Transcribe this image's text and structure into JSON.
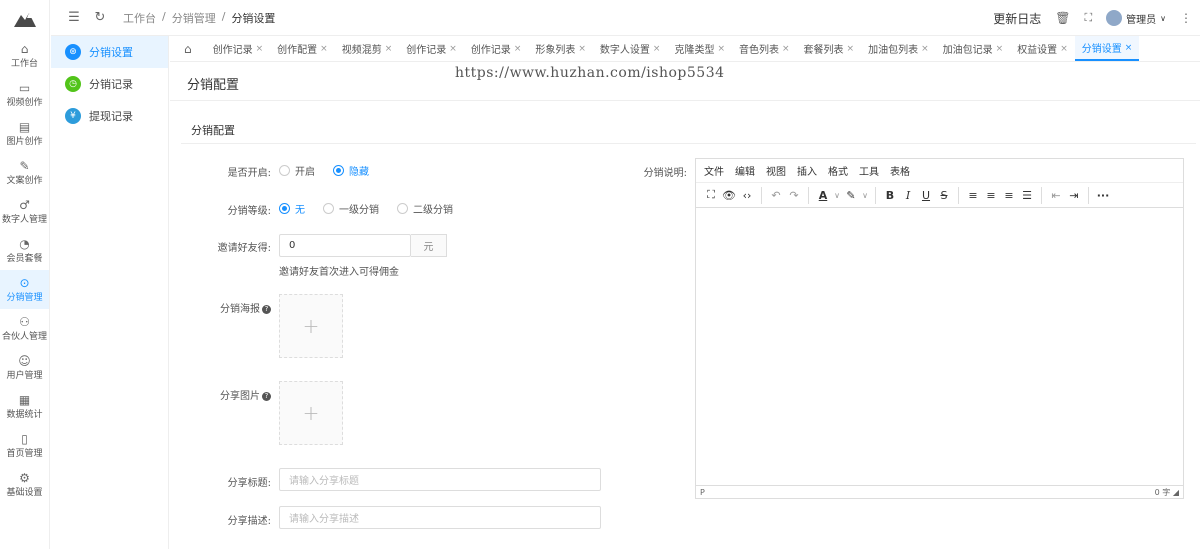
{
  "topbar": {
    "breadcrumb": [
      "工作台",
      "分销管理",
      "分销设置"
    ],
    "update_log": "更新日志",
    "user": "管理员"
  },
  "leftnav": [
    {
      "label": "工作台",
      "icon": "home-icon",
      "glyph": "⌂"
    },
    {
      "label": "视频创作",
      "icon": "video-icon",
      "glyph": "▭"
    },
    {
      "label": "图片创作",
      "icon": "image-icon",
      "glyph": "▤"
    },
    {
      "label": "文案创作",
      "icon": "document-icon",
      "glyph": "✎"
    },
    {
      "label": "数字人管理",
      "icon": "digital-human-icon",
      "glyph": "♂"
    },
    {
      "label": "会员套餐",
      "icon": "membership-icon",
      "glyph": "◔"
    },
    {
      "label": "分销管理",
      "icon": "distribution-icon",
      "glyph": "⊙"
    },
    {
      "label": "合伙人管理",
      "icon": "partner-icon",
      "glyph": "⚇"
    },
    {
      "label": "用户管理",
      "icon": "user-icon",
      "glyph": "☺"
    },
    {
      "label": "数据统计",
      "icon": "statistics-icon",
      "glyph": "▦"
    },
    {
      "label": "首页管理",
      "icon": "tablet-icon",
      "glyph": "▯"
    },
    {
      "label": "基础设置",
      "icon": "settings-icon",
      "glyph": "⚙"
    }
  ],
  "submenu": [
    {
      "label": "分销设置",
      "color": "#1890ff",
      "glyph": "⊛"
    },
    {
      "label": "分销记录",
      "color": "#52c41a",
      "glyph": "◷"
    },
    {
      "label": "提现记录",
      "color": "#2d9cdb",
      "glyph": "¥"
    }
  ],
  "tabs": [
    "创作记录",
    "创作配置",
    "视频混剪",
    "创作记录",
    "创作记录",
    "形象列表",
    "数字人设置",
    "克隆类型",
    "音色列表",
    "套餐列表",
    "加油包列表",
    "加油包记录",
    "权益设置",
    "分销设置"
  ],
  "watermark": "https://www.huzhan.com/ishop5534",
  "page_title": "分销配置",
  "section_title": "分销配置",
  "form": {
    "enable_label": "是否开启:",
    "enable_options": [
      "开启",
      "隐藏"
    ],
    "level_label": "分销等级:",
    "level_options": [
      "无",
      "一级分销",
      "二级分销"
    ],
    "invite_label": "邀请好友得:",
    "invite_value": "0",
    "invite_unit": "元",
    "invite_hint": "邀请好友首次进入可得佣金",
    "poster_label": "分销海报",
    "share_image_label": "分享图片",
    "share_title_label": "分享标题:",
    "share_title_placeholder": "请输入分享标题",
    "share_desc_label": "分享描述:",
    "share_desc_placeholder": "请输入分享描述",
    "desc_label": "分销说明:"
  },
  "editor": {
    "menu": [
      "文件",
      "编辑",
      "视图",
      "插入",
      "格式",
      "工具",
      "表格"
    ],
    "status_path": "P",
    "word_count": "0 字"
  },
  "colors": {
    "accent": "#1890ff"
  }
}
